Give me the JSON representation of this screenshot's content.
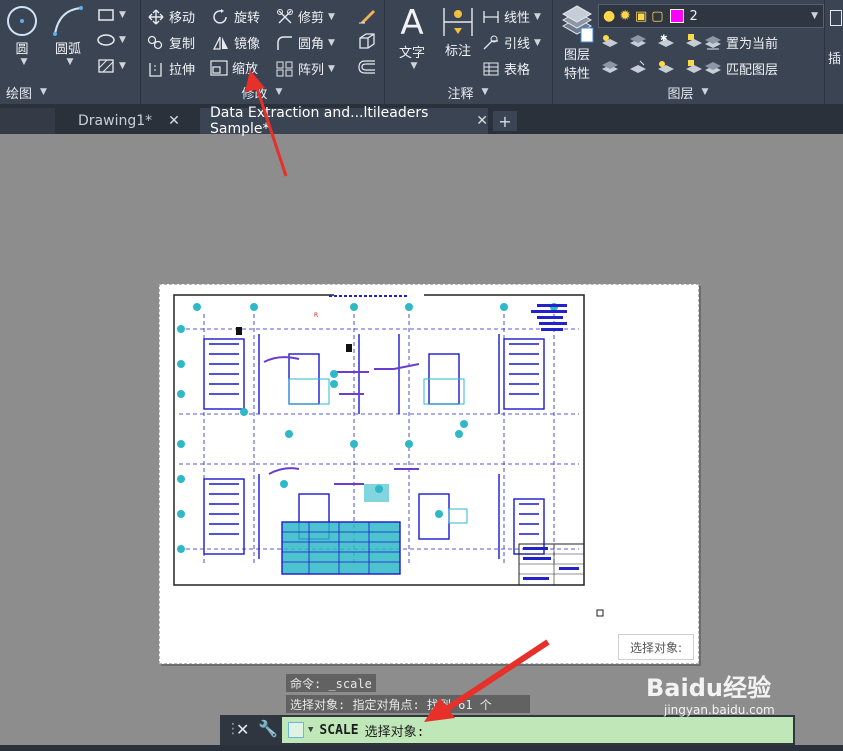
{
  "ribbon": {
    "draw_panel": {
      "circle_label": "圆",
      "arc_label": "圆弧",
      "panel_label": "绘图"
    },
    "modify_panel": {
      "move": "移动",
      "rotate": "旋转",
      "trim": "修剪",
      "copy": "复制",
      "mirror": "镜像",
      "fillet": "圆角",
      "stretch": "拉伸",
      "scale": "缩放",
      "array": "阵列",
      "panel_label": "修改"
    },
    "annotation_panel": {
      "text": "文字",
      "dimension": "标注",
      "linear": "线性",
      "leader": "引线",
      "table": "表格",
      "panel_label": "注释"
    },
    "layers_panel": {
      "layer_props_line1": "图层",
      "layer_props_line2": "特性",
      "layer_name": "2",
      "set_current": "置为当前",
      "match_layer": "匹配图层",
      "panel_label": "图层",
      "layer_color": "#ff00ff"
    },
    "cut_label": "插"
  },
  "tabs": [
    {
      "label": "Drawing1*"
    },
    {
      "label": "Data Extraction and...ltileaders Sample*"
    }
  ],
  "canvas": {
    "tooltip": "选择对象:"
  },
  "command_history": [
    "命令: _scale",
    "选择对象: 指定对角点: 找到 61 个"
  ],
  "command_line": {
    "command": "SCALE",
    "prompt": "选择对象:"
  },
  "watermark": {
    "brand": "Baidu经验",
    "url": "jingyan.baidu.com"
  },
  "colors": {
    "accent_arrow": "#e8302a",
    "drawing_blue": "#2222cc",
    "drawing_cyan": "#2fb8c8"
  }
}
